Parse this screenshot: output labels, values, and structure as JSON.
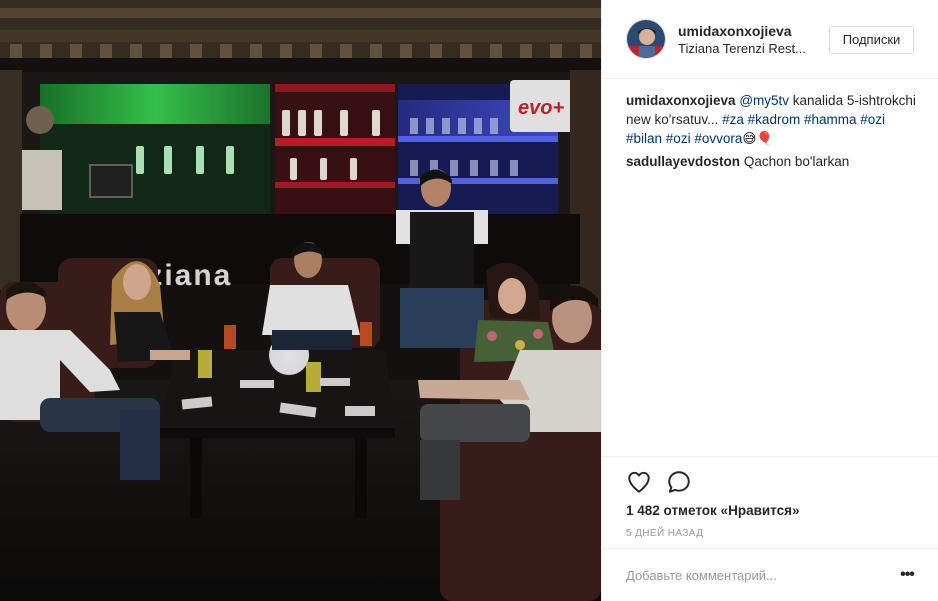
{
  "post": {
    "photo": {
      "sign_text": "tiziana",
      "channel_logo": "evo+",
      "colors": {
        "green_light": "#2fbf4a",
        "red_light": "#c8202a",
        "blue_light": "#3a4cd6",
        "backdrop": "#141210"
      }
    },
    "header": {
      "username": "umidaxonxojieva",
      "location": "Tiziana Terenzi Rest...",
      "follow_label": "Подписки",
      "avatar_icon": "user-avatar"
    },
    "comments": [
      {
        "user": "umidaxonxojieva",
        "parts": [
          {
            "type": "link",
            "text": "@my5tv"
          },
          {
            "type": "text",
            "text": " kanalida 5-ishtrokchi new ko'rsatuv... "
          },
          {
            "type": "link",
            "text": "#za"
          },
          {
            "type": "text",
            "text": " "
          },
          {
            "type": "link",
            "text": "#kadrom"
          },
          {
            "type": "text",
            "text": " "
          },
          {
            "type": "link",
            "text": "#hamma"
          },
          {
            "type": "text",
            "text": " "
          },
          {
            "type": "link",
            "text": "#ozi"
          },
          {
            "type": "text",
            "text": " "
          },
          {
            "type": "link",
            "text": "#bilan"
          },
          {
            "type": "text",
            "text": " "
          },
          {
            "type": "link",
            "text": "#ozi"
          },
          {
            "type": "text",
            "text": " "
          },
          {
            "type": "link",
            "text": "#ovvora"
          },
          {
            "type": "text",
            "text": "😅🎈"
          }
        ]
      },
      {
        "user": "sadullayevdoston",
        "parts": [
          {
            "type": "text",
            "text": "Qachon bo'larkan"
          }
        ]
      }
    ],
    "actions": {
      "like_icon": "heart-icon",
      "comment_icon": "comment-bubble-icon",
      "likes_text": "1 482 отметок «Нравится»",
      "time_text": "5 ДНЕЙ НАЗАД"
    },
    "add_comment": {
      "placeholder": "Добавьте комментарий...",
      "more_label": "•••"
    }
  }
}
